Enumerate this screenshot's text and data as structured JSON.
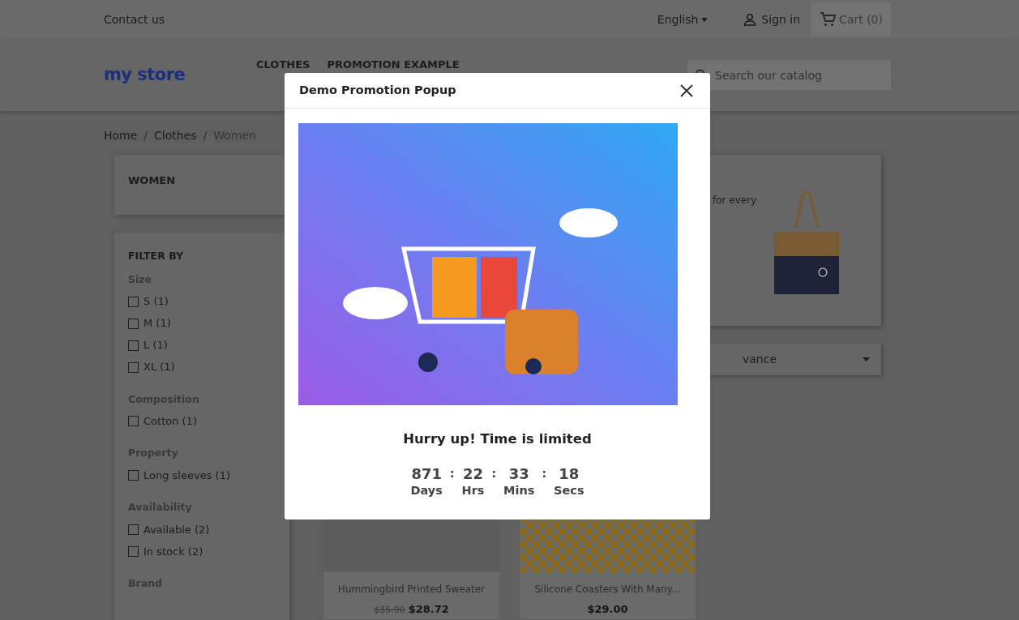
{
  "top_bar": {
    "contact": "Contact us",
    "language": "English",
    "sign_in": "Sign in",
    "cart": "Cart (0)"
  },
  "header": {
    "logo": "my store",
    "nav": [
      "CLOTHES",
      "PROMOTION EXAMPLE"
    ],
    "search": {
      "placeholder": "Search our catalog"
    }
  },
  "breadcrumb": [
    {
      "label": "Home",
      "separator": "/"
    },
    {
      "label": "Clothes",
      "separator": "/"
    },
    {
      "label": "Women"
    }
  ],
  "category_title": "WOMEN",
  "filters": {
    "title": "FILTER BY",
    "groups": [
      {
        "name": "Size",
        "options": [
          {
            "label": "S (1)",
            "checked": false
          },
          {
            "label": "M (1)",
            "checked": false
          },
          {
            "label": "L (1)",
            "checked": false
          },
          {
            "label": "XL (1)",
            "checked": false
          }
        ]
      },
      {
        "name": "Composition",
        "options": [
          {
            "label": "Cotton (1)",
            "checked": false
          }
        ]
      },
      {
        "name": "Property",
        "options": [
          {
            "label": "Long sleeves (1)",
            "checked": false
          }
        ]
      },
      {
        "name": "Availability",
        "options": [
          {
            "label": "Available (2)",
            "checked": false
          },
          {
            "label": "In stock (2)",
            "checked": false
          }
        ]
      },
      {
        "name": "Brand"
      }
    ]
  },
  "category_banner": {
    "text": "for every"
  },
  "sort": {
    "value": "vance"
  },
  "products": [
    {
      "name": "Hummingbird Printed Sweater",
      "regular_price": "$35.90",
      "price": "$28.72"
    },
    {
      "name": "Silicone Coasters With Many...",
      "price": "$29.00"
    }
  ],
  "popup": {
    "title": "Demo Promotion Popup",
    "message": "Hurry up! Time is limited",
    "countdown": [
      {
        "value": "871",
        "unit": "Days",
        "separator": ":"
      },
      {
        "value": "22",
        "unit": "Hrs",
        "separator": ":"
      },
      {
        "value": "33",
        "unit": "Mins",
        "separator": ":"
      },
      {
        "value": "18",
        "unit": "Secs"
      }
    ]
  }
}
